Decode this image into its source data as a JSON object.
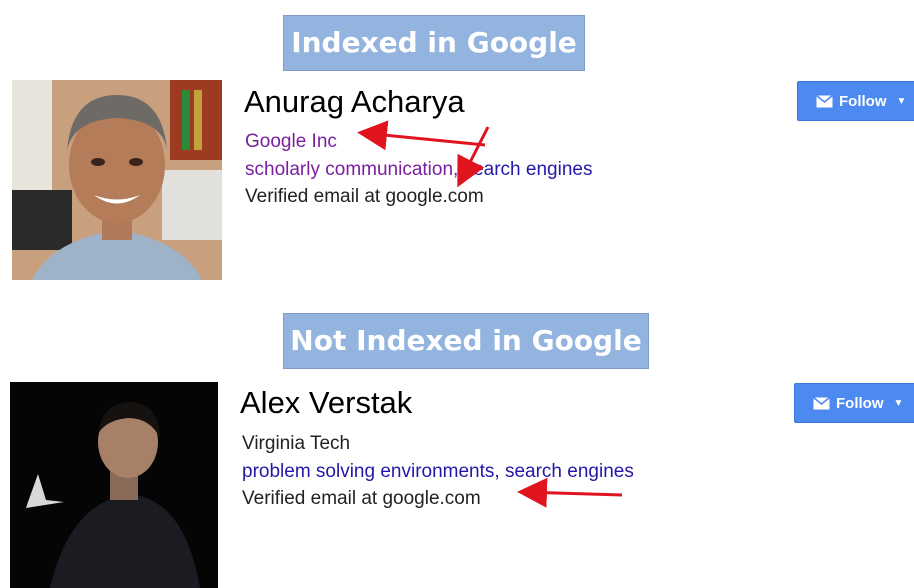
{
  "banners": {
    "indexed": "Indexed in Google",
    "not_indexed": "Not Indexed in Google"
  },
  "profiles": [
    {
      "name": "Anurag Acharya",
      "affiliation": "Google Inc",
      "topic1": "scholarly communication",
      "separator": ", ",
      "topic2": "search engines",
      "email": "Verified email at google.com",
      "follow_label": "Follow"
    },
    {
      "name": "Alex Verstak",
      "affiliation": "Virginia Tech",
      "topic1": "problem solving environments",
      "separator": ", ",
      "topic2": "search engines",
      "email": "Verified email at google.com",
      "follow_label": "Follow"
    }
  ],
  "colors": {
    "banner_bg": "#94b4e0",
    "follow_bg": "#4c8af2",
    "arrow": "#e0141e",
    "link_purple": "#7a1fa0",
    "link_blue": "#2418a8"
  },
  "icons": [
    "mail-icon",
    "caret-down-icon",
    "arrow-annotation"
  ]
}
